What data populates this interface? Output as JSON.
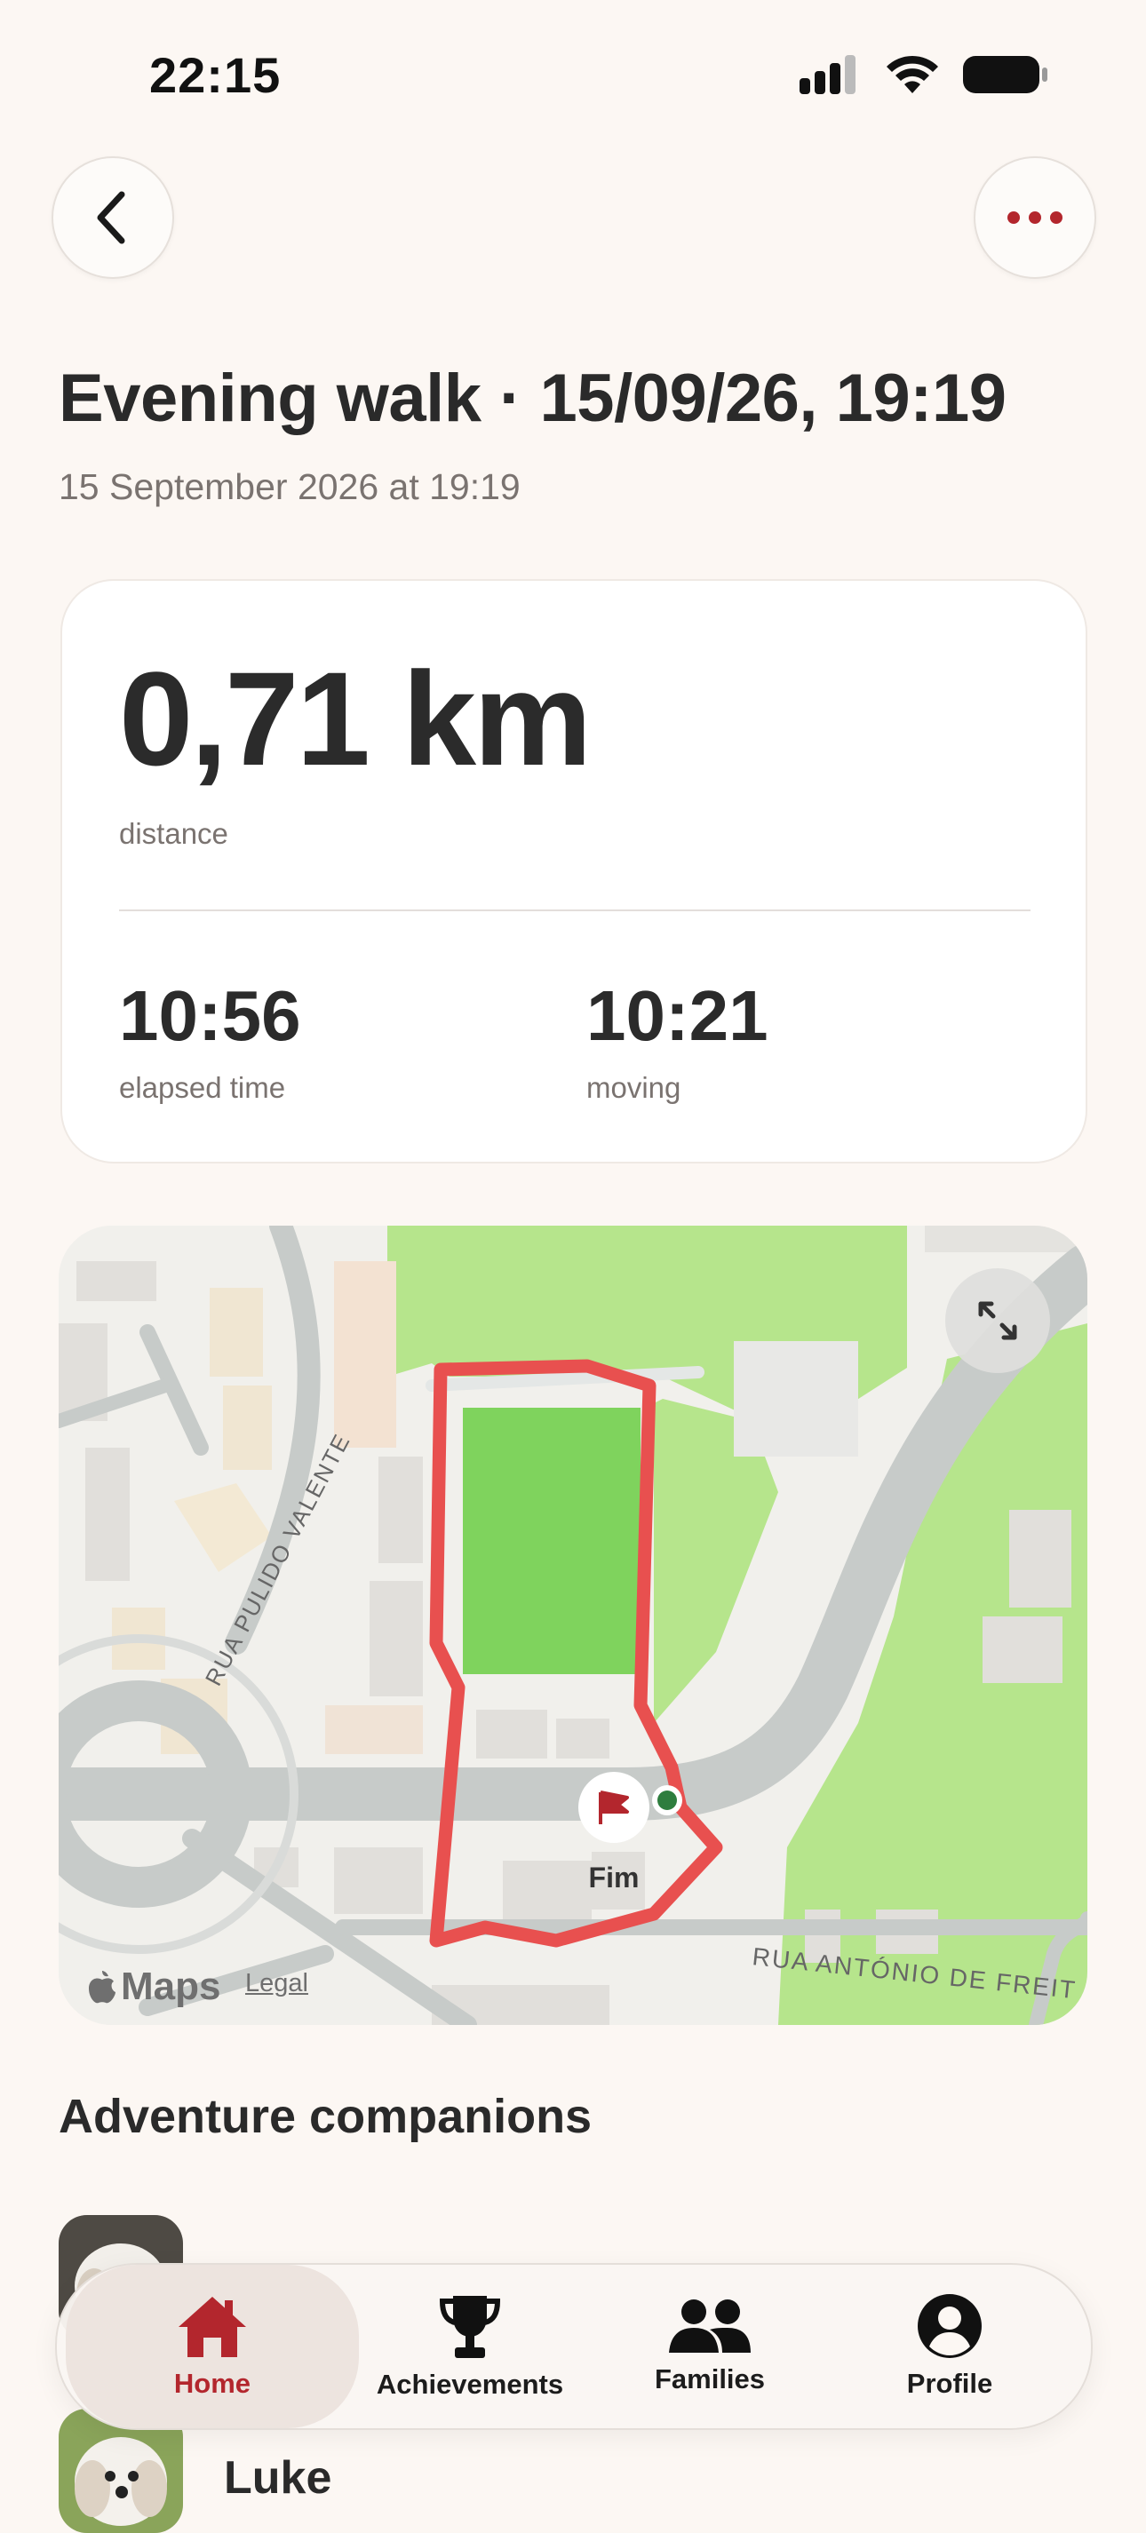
{
  "status_bar": {
    "time": "22:15"
  },
  "header": {
    "title": "Evening walk · 15/09/26, 19:19",
    "subtitle": "15 September 2026 at 19:19"
  },
  "stats": {
    "distance_value": "0,71 km",
    "distance_label": "distance",
    "elapsed_value": "10:56",
    "elapsed_label": "elapsed time",
    "moving_value": "10:21",
    "moving_label": "moving"
  },
  "map": {
    "street_1": "RUA PULIDO VALENTE",
    "street_2": "RUA ANTÓNIO DE FREIT",
    "marker_label": "Fim",
    "brand": "Maps",
    "legal": "Legal",
    "route_color": "#e8504f"
  },
  "companions": {
    "title": "Adventure companions",
    "items": [
      {
        "name": ""
      },
      {
        "name": "Luke"
      }
    ]
  },
  "tabbar": {
    "items": [
      {
        "label": "Home",
        "icon": "house-icon",
        "active": true
      },
      {
        "label": "Achievements",
        "icon": "trophy-icon"
      },
      {
        "label": "Families",
        "icon": "people-icon"
      },
      {
        "label": "Profile",
        "icon": "person-circle-icon"
      }
    ],
    "active_color": "#b3262d"
  }
}
